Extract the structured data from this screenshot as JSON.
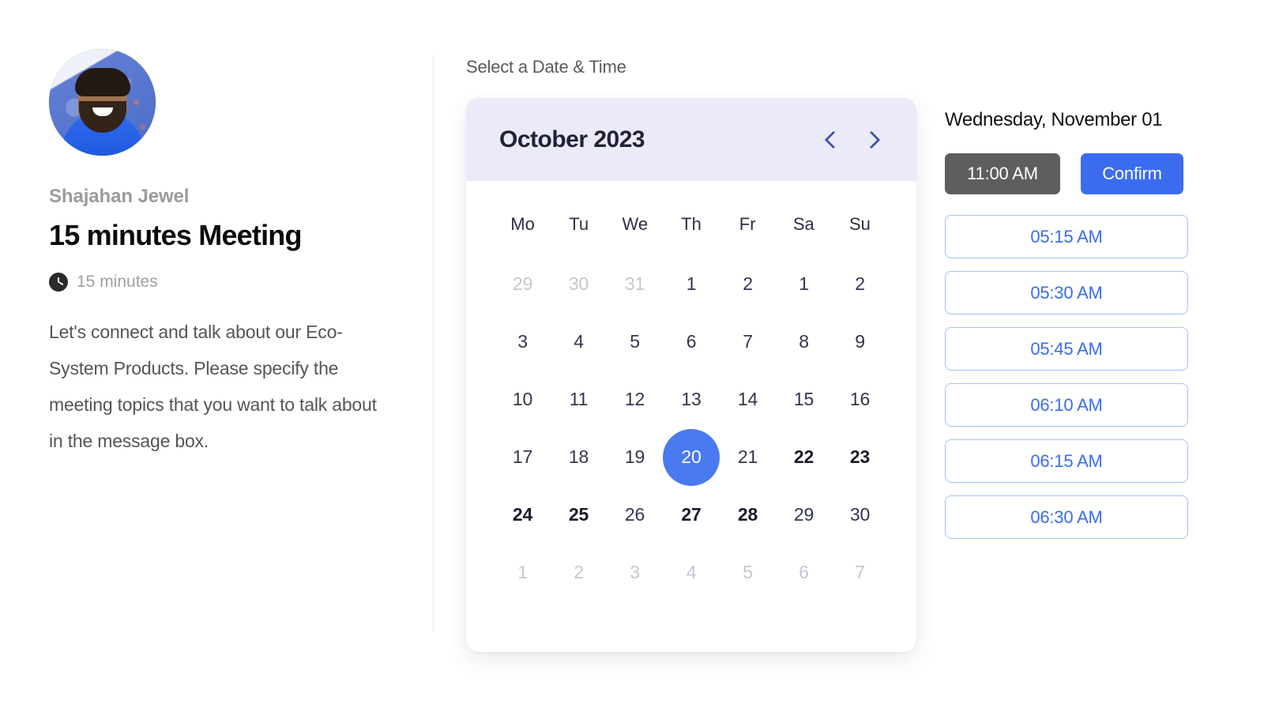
{
  "host": {
    "name": "Shajahan Jewel",
    "avatar_icon": "user-avatar-photo"
  },
  "meeting": {
    "title": "15 minutes Meeting",
    "duration_icon": "clock-icon",
    "duration": "15 minutes",
    "description": "Let's connect and talk about our Eco-System Products. Please specify the meeting topics that you want to talk about in the message box."
  },
  "scheduler": {
    "section_label": "Select a Date & Time"
  },
  "calendar": {
    "month_label": "October 2023",
    "prev_icon": "chevron-left-icon",
    "next_icon": "chevron-right-icon",
    "weekdays": [
      "Mo",
      "Tu",
      "We",
      "Th",
      "Fr",
      "Sa",
      "Su"
    ],
    "weeks": [
      [
        {
          "label": "29",
          "state": "muted"
        },
        {
          "label": "30",
          "state": "muted"
        },
        {
          "label": "31",
          "state": "muted"
        },
        {
          "label": "1",
          "state": "normal"
        },
        {
          "label": "2",
          "state": "normal"
        },
        {
          "label": "1",
          "state": "normal"
        },
        {
          "label": "2",
          "state": "normal"
        }
      ],
      [
        {
          "label": "3",
          "state": "normal"
        },
        {
          "label": "4",
          "state": "normal"
        },
        {
          "label": "5",
          "state": "normal"
        },
        {
          "label": "6",
          "state": "normal"
        },
        {
          "label": "7",
          "state": "normal"
        },
        {
          "label": "8",
          "state": "normal"
        },
        {
          "label": "9",
          "state": "normal"
        }
      ],
      [
        {
          "label": "10",
          "state": "normal"
        },
        {
          "label": "11",
          "state": "normal"
        },
        {
          "label": "12",
          "state": "normal"
        },
        {
          "label": "13",
          "state": "normal"
        },
        {
          "label": "14",
          "state": "normal"
        },
        {
          "label": "15",
          "state": "normal"
        },
        {
          "label": "16",
          "state": "normal"
        }
      ],
      [
        {
          "label": "17",
          "state": "normal"
        },
        {
          "label": "18",
          "state": "normal"
        },
        {
          "label": "19",
          "state": "normal"
        },
        {
          "label": "20",
          "state": "selected"
        },
        {
          "label": "21",
          "state": "normal"
        },
        {
          "label": "22",
          "state": "bold"
        },
        {
          "label": "23",
          "state": "bold"
        }
      ],
      [
        {
          "label": "24",
          "state": "bold"
        },
        {
          "label": "25",
          "state": "bold"
        },
        {
          "label": "26",
          "state": "normal"
        },
        {
          "label": "27",
          "state": "bold"
        },
        {
          "label": "28",
          "state": "bold"
        },
        {
          "label": "29",
          "state": "normal"
        },
        {
          "label": "30",
          "state": "normal"
        }
      ],
      [
        {
          "label": "1",
          "state": "muted"
        },
        {
          "label": "2",
          "state": "muted"
        },
        {
          "label": "3",
          "state": "muted"
        },
        {
          "label": "4",
          "state": "muted"
        },
        {
          "label": "5",
          "state": "muted"
        },
        {
          "label": "6",
          "state": "muted"
        },
        {
          "label": "7",
          "state": "muted"
        }
      ]
    ],
    "selected_day": "20"
  },
  "slots": {
    "date_header": "Wednesday, November 01",
    "selected_time": "11:00 AM",
    "confirm_label": "Confirm",
    "times": [
      "05:15 AM",
      "05:30 AM",
      "05:45 AM",
      "06:10 AM",
      "06:15 AM",
      "06:30 AM"
    ]
  },
  "colors": {
    "accent": "#3b6cf0",
    "selected_day": "#4a7af0",
    "header_bg": "#ebeaf8",
    "chip_gray": "#5e5e5e",
    "slot_border": "#a8c0f5"
  }
}
